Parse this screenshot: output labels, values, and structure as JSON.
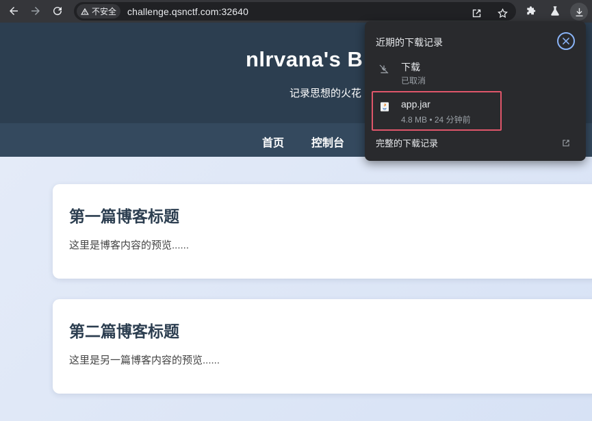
{
  "browser": {
    "security_label": "不安全",
    "url": "challenge.qsnctf.com:32640",
    "icons": [
      "back-icon",
      "forward-icon",
      "reload-icon",
      "warning-icon",
      "share-icon",
      "star-icon",
      "extensions-icon",
      "labs-icon",
      "download-icon"
    ]
  },
  "header": {
    "title": "nlrvana's B",
    "tagline": "记录思想的火花"
  },
  "nav": {
    "home": "首页",
    "console": "控制台"
  },
  "posts": [
    {
      "title": "第一篇博客标题",
      "preview": "这里是博客内容的预览......"
    },
    {
      "title": "第二篇博客标题",
      "preview": "这里是另一篇博客内容的预览......"
    }
  ],
  "downloads": {
    "title": "近期的下载记录",
    "items": [
      {
        "name": "下载",
        "status": "已取消",
        "icon": "download-cancelled-icon"
      },
      {
        "name": "app.jar",
        "status": "4.8 MB • 24 分钟前",
        "icon": "java-file-icon"
      }
    ],
    "full_history": "完整的下载记录"
  },
  "colors": {
    "toolbar": "#35363a",
    "header": "#2c3e50",
    "nav": "#34495e",
    "highlight": "#e0566a",
    "accent": "#8ab4f8"
  }
}
